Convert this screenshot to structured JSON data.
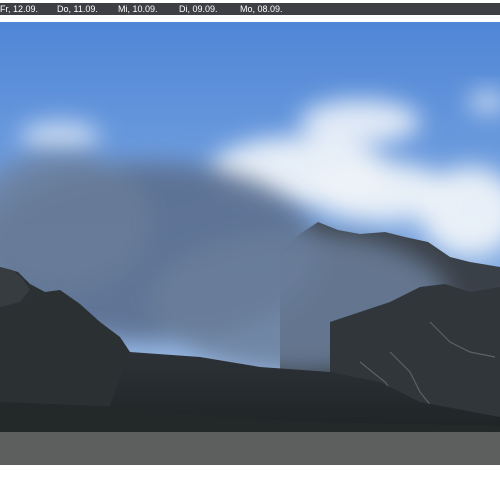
{
  "date_tabs": [
    {
      "label": "Fr, 12.09."
    },
    {
      "label": "Do, 11.09."
    },
    {
      "label": "Mi, 10.09."
    },
    {
      "label": "Di, 09.09."
    },
    {
      "label": "Mo, 08.09."
    }
  ],
  "colors": {
    "tab_bar": "#3e3f44",
    "sky_top": "#4f86d6",
    "sky_bottom": "#a9c6ea",
    "cloud": "#e6edf5",
    "fog": "#5a6e8c",
    "mountain": "#2a2f33",
    "bottom_bar": "#5c5f5e"
  },
  "image": {
    "subject": "mountain-webcam-image"
  }
}
